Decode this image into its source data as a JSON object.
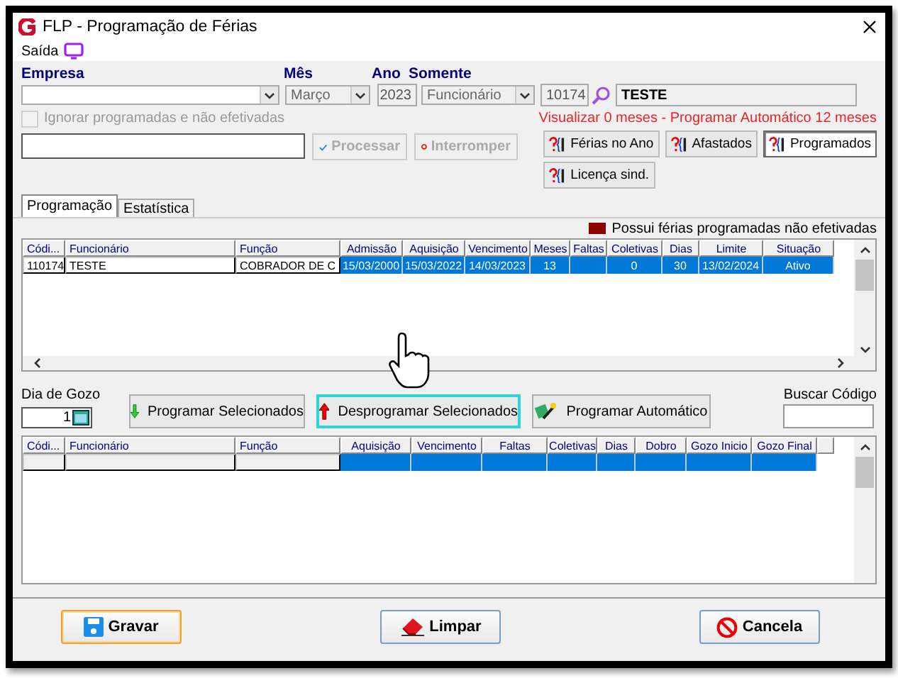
{
  "window": {
    "title": "FLP - Programação de Férias"
  },
  "menu": [
    {
      "label": "Saída"
    }
  ],
  "filters": {
    "empresa": {
      "label": "Empresa"
    },
    "mes": {
      "label": "Mês",
      "value": "Março"
    },
    "ano": {
      "label": "Ano",
      "value": "2023"
    },
    "somente": {
      "label": "Somente",
      "value": "Funcionário"
    },
    "codigo": {
      "value": "10174"
    },
    "nome": {
      "value": "TESTE"
    }
  },
  "ignore_checkbox": {
    "label": "Ignorar programadas e não efetivadas",
    "checked": false,
    "disabled": true
  },
  "info_text": "Visualizar 0 meses - Programar Automático 12 meses",
  "actions": [
    {
      "label": "Processar",
      "kind": "check",
      "disabled": true
    },
    {
      "label": "Interromper",
      "kind": "stop",
      "disabled": true
    }
  ],
  "lookup_buttons": [
    {
      "label": "Férias no Ano",
      "selected": false
    },
    {
      "label": "Afastados",
      "selected": false
    },
    {
      "label": "Programados",
      "selected": true
    },
    {
      "label": "Licença sind.",
      "selected": false
    }
  ],
  "tabs": [
    {
      "label": "Programação",
      "selected": true
    },
    {
      "label": "Estatística",
      "selected": false
    }
  ],
  "legend": {
    "label": "Possui férias programadas não efetivadas",
    "color": "#8b0000"
  },
  "table": {
    "columns": [
      {
        "label": "Códi...",
        "fixed": true
      },
      {
        "label": "Funcionário",
        "fixed": true
      },
      {
        "label": "Função",
        "fixed": true
      },
      {
        "label": "Admissão",
        "fixed": false
      },
      {
        "label": "Aquisição",
        "fixed": false
      },
      {
        "label": "Vencimento",
        "fixed": false
      },
      {
        "label": "Meses",
        "fixed": false
      },
      {
        "label": "Faltas",
        "fixed": false
      },
      {
        "label": "Coletivas",
        "fixed": false
      },
      {
        "label": "Dias",
        "fixed": false
      },
      {
        "label": "Limite",
        "fixed": false
      },
      {
        "label": "Situação",
        "fixed": false
      }
    ],
    "rows": [
      {
        "selected": true,
        "cells": [
          "110174",
          "TESTE",
          "COBRADOR DE C",
          "15/03/2000",
          "15/03/2022",
          "14/03/2023",
          "13",
          "",
          "0",
          "30",
          "13/02/2024",
          "Ativo"
        ]
      }
    ]
  },
  "dia_de_gozo": {
    "label": "Dia de Gozo",
    "value": "1"
  },
  "program_buttons": [
    {
      "label": "Programar Selecionados",
      "kind": "down",
      "focused": false
    },
    {
      "label": "Desprogramar Selecionados",
      "kind": "up",
      "focused": true
    },
    {
      "label": "Programar Automático",
      "kind": "auto",
      "focused": false
    }
  ],
  "buscar_codigo": {
    "label": "Buscar Código"
  },
  "table2": {
    "columns": [
      {
        "label": "Códi...",
        "fixed": true
      },
      {
        "label": "Funcionário",
        "fixed": true
      },
      {
        "label": "Função",
        "fixed": true
      },
      {
        "label": "Aquisição",
        "fixed": false
      },
      {
        "label": "Vencimento",
        "fixed": false
      },
      {
        "label": "Faltas",
        "fixed": false
      },
      {
        "label": "Coletivas",
        "fixed": false
      },
      {
        "label": "Dias",
        "fixed": false
      },
      {
        "label": "Dobro",
        "fixed": false
      },
      {
        "label": "Gozo Inicio",
        "fixed": false
      },
      {
        "label": "Gozo Final",
        "fixed": false
      }
    ],
    "rows": [
      {
        "selected": true
      }
    ]
  },
  "footer_buttons": [
    {
      "label": "Gravar",
      "kind": "save",
      "default": true
    },
    {
      "label": "Limpar",
      "kind": "clear",
      "default": false
    },
    {
      "label": "Cancela",
      "kind": "cancel",
      "default": false
    }
  ]
}
